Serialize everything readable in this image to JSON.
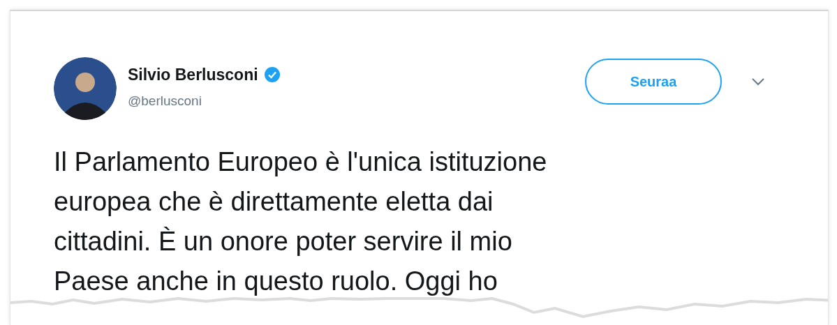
{
  "tweet": {
    "author": {
      "name": "Silvio Berlusconi",
      "verified": true,
      "handle": "@berlusconi"
    },
    "follow_button": "Seuraa",
    "text_lines": [
      "Il Parlamento Europeo è l'unica istituzione",
      "europea che è direttamente eletta dai",
      "cittadini. È un onore poter servire il mio",
      "Paese anche in questo ruolo. Oggi ho"
    ]
  }
}
